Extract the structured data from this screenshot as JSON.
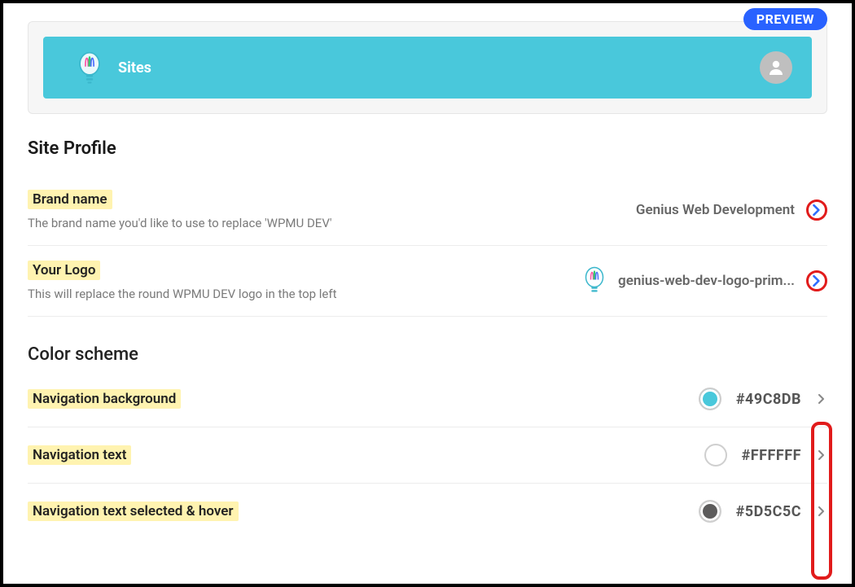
{
  "preview_badge": "PREVIEW",
  "preview_bar": {
    "title": "Sites"
  },
  "sections": {
    "site_profile": {
      "title": "Site Profile",
      "brand": {
        "label": "Brand name",
        "desc": "The brand name you'd like to use to replace 'WPMU DEV'",
        "value": "Genius Web Development"
      },
      "logo": {
        "label": "Your Logo",
        "desc": "This will replace the round WPMU DEV logo in the top left",
        "value": "genius-web-dev-logo-prim..."
      }
    },
    "color_scheme": {
      "title": "Color scheme",
      "items": [
        {
          "label": "Navigation background",
          "hex": "#49C8DB"
        },
        {
          "label": "Navigation text",
          "hex": "#FFFFFF"
        },
        {
          "label": "Navigation text selected & hover",
          "hex": "#5D5C5C"
        }
      ]
    }
  }
}
